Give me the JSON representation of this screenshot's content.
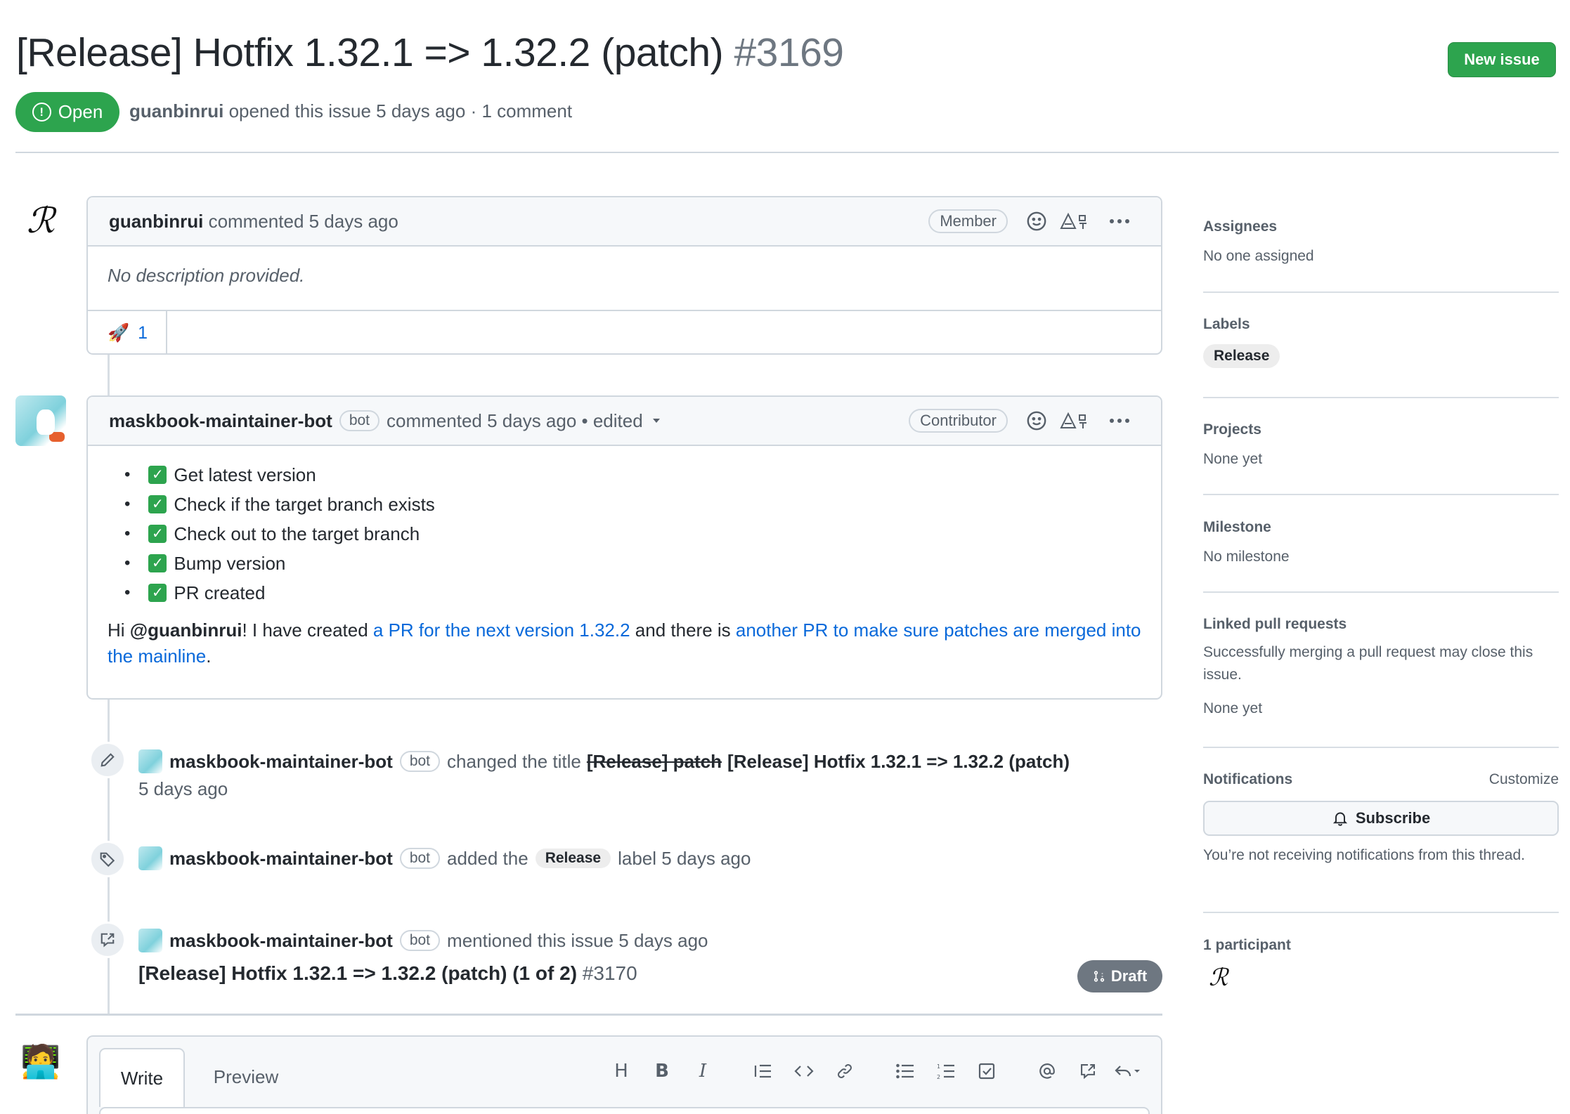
{
  "header": {
    "title": "[Release] Hotfix 1.32.1 => 1.32.2 (patch)",
    "number": "#3169",
    "new_issue_label": "New issue",
    "state": "Open",
    "author": "guanbinrui",
    "opened_text": "opened this issue 5 days ago · 1 comment"
  },
  "comments": [
    {
      "author": "guanbinrui",
      "action": "commented 5 days ago",
      "role": "Member",
      "body": "No description provided.",
      "reaction_emoji": "🚀",
      "reaction_count": "1"
    },
    {
      "author": "maskbook-maintainer-bot",
      "bot_badge": "bot",
      "action": "commented 5 days ago • edited",
      "role": "Contributor",
      "checklist": [
        "Get latest version",
        "Check if the target branch exists",
        "Check out to the target branch",
        "Bump version",
        "PR created"
      ],
      "text_hi": "Hi ",
      "mention": "@guanbinrui",
      "text_mid": "! I have created ",
      "link1": "a PR for the next version 1.32.2",
      "text_and": " and there is ",
      "link2": "another PR to make sure patches are merged into the mainline",
      "text_end": "."
    }
  ],
  "events": [
    {
      "actor": "maskbook-maintainer-bot",
      "bot_badge": "bot",
      "action": "changed the title",
      "old_title": "[Release] patch",
      "new_title": "[Release] Hotfix 1.32.1 => 1.32.2 (patch)",
      "time": "5 days ago"
    },
    {
      "actor": "maskbook-maintainer-bot",
      "bot_badge": "bot",
      "action": "added the",
      "label": "Release",
      "suffix": "label 5 days ago"
    },
    {
      "actor": "maskbook-maintainer-bot",
      "bot_badge": "bot",
      "action": "mentioned this issue 5 days ago",
      "ref_title": "[Release] Hotfix 1.32.1 => 1.32.2 (patch) (1 of 2)",
      "ref_number": "#3170",
      "ref_state": "Draft"
    }
  ],
  "compose": {
    "tab_write": "Write",
    "tab_preview": "Preview"
  },
  "sidebar": {
    "assignees_heading": "Assignees",
    "assignees_value": "No one assigned",
    "labels_heading": "Labels",
    "label": "Release",
    "projects_heading": "Projects",
    "projects_value": "None yet",
    "milestone_heading": "Milestone",
    "milestone_value": "No milestone",
    "linked_heading": "Linked pull requests",
    "linked_desc": "Successfully merging a pull request may close this issue.",
    "linked_value": "None yet",
    "notifications_heading": "Notifications",
    "customize_label": "Customize",
    "subscribe_label": "Subscribe",
    "notifications_desc": "You’re not receiving notifications from this thread.",
    "participants_heading": "1 participant"
  },
  "colors": {
    "open_green": "#2da44e",
    "link_blue": "#0969da",
    "draft_gray": "#6e7781"
  },
  "icons": [
    "open-issue-icon",
    "smiley-icon",
    "translate-icon",
    "kebab-icon",
    "pencil-icon",
    "tag-icon",
    "cross-reference-icon",
    "pull-request-draft-icon",
    "bell-icon",
    "heading-icon",
    "bold-icon",
    "italic-icon",
    "quote-icon",
    "code-icon",
    "link-icon",
    "unordered-list-icon",
    "ordered-list-icon",
    "task-list-icon",
    "mention-icon",
    "reference-icon",
    "reply-icon"
  ]
}
